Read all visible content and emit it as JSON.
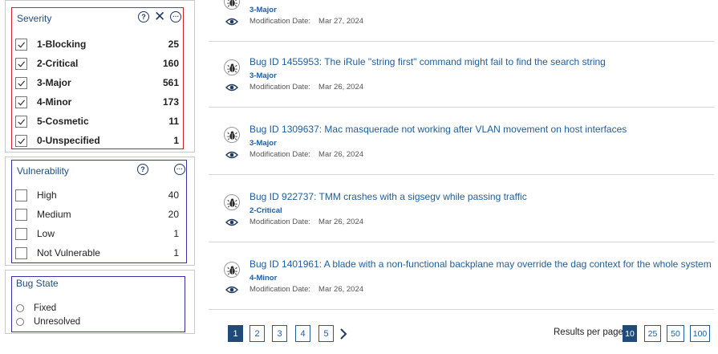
{
  "severity": {
    "title": "Severity",
    "items": [
      {
        "label": "1-Blocking",
        "count": "25",
        "checked": true
      },
      {
        "label": "2-Critical",
        "count": "160",
        "checked": true
      },
      {
        "label": "3-Major",
        "count": "561",
        "checked": true
      },
      {
        "label": "4-Minor",
        "count": "173",
        "checked": true
      },
      {
        "label": "5-Cosmetic",
        "count": "11",
        "checked": true
      },
      {
        "label": "0-Unspecified",
        "count": "1",
        "checked": true
      }
    ]
  },
  "vulnerability": {
    "title": "Vulnerability",
    "items": [
      {
        "label": "High",
        "count": "40",
        "checked": false
      },
      {
        "label": "Medium",
        "count": "20",
        "checked": false
      },
      {
        "label": "Low",
        "count": "1",
        "checked": false
      },
      {
        "label": "Not Vulnerable",
        "count": "1",
        "checked": false
      }
    ]
  },
  "bug_state": {
    "title": "Bug State",
    "options": [
      {
        "label": "Fixed",
        "selected": false
      },
      {
        "label": "Unresolved",
        "selected": false
      }
    ]
  },
  "results": {
    "mod_label": "Modification Date:",
    "items": [
      {
        "title": "",
        "severity": "3-Major",
        "date": "Mar 27, 2024"
      },
      {
        "title": "Bug ID 1455953: The iRule \"string first\" command might fail to find the search string",
        "severity": "3-Major",
        "date": "Mar 26, 2024"
      },
      {
        "title": "Bug ID 1309637: Mac masquerade not working after VLAN movement on host interfaces",
        "severity": "3-Major",
        "date": "Mar 26, 2024"
      },
      {
        "title": "Bug ID 922737: TMM crashes with a sigsegv while passing traffic",
        "severity": "2-Critical",
        "date": "Mar 26, 2024"
      },
      {
        "title": "Bug ID 1401961: A blade with a non-functional backplane may override the dag context for the whole system",
        "severity": "4-Minor",
        "date": "Mar 26, 2024"
      }
    ]
  },
  "pagination": {
    "pages": [
      "1",
      "2",
      "3",
      "4",
      "5"
    ],
    "current": "1",
    "results_per_page_label": "Results per page",
    "per_page_options": [
      "10",
      "25",
      "50",
      "100"
    ],
    "per_page_selected": "10"
  },
  "colors": {
    "link": "#1f5d9c",
    "active_page": "#1e4b7a",
    "severity_highlight": "#d21f2b",
    "filter_highlight": "#3333a6"
  }
}
